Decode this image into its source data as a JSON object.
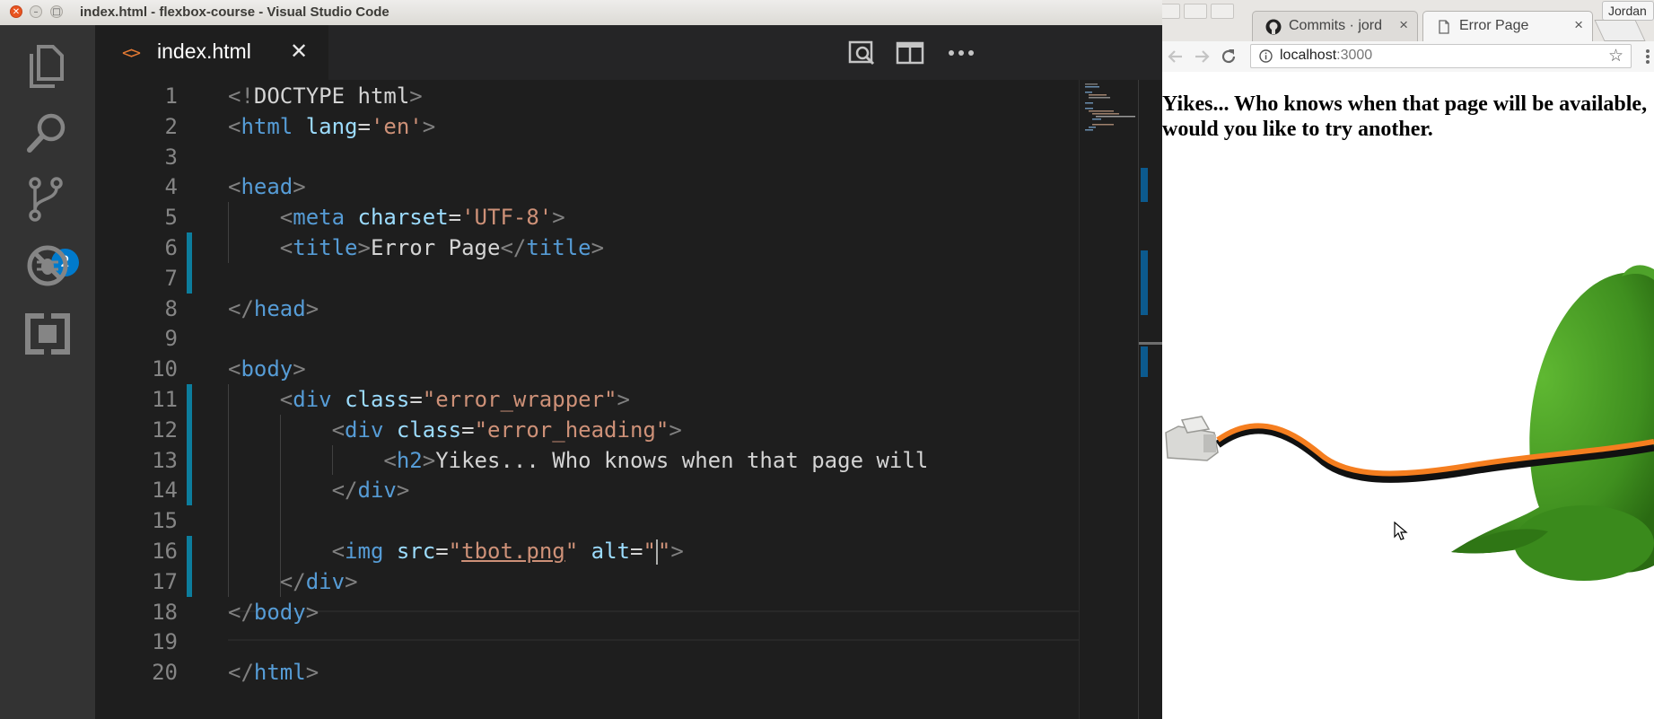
{
  "vscode": {
    "window_title": "index.html - flexbox-course - Visual Studio Code",
    "scm_badge": "2",
    "tab": {
      "label": "index.html",
      "close_icon": "✕",
      "file_icon": "<>"
    },
    "lines": [
      {
        "n": "1",
        "tokens": [
          [
            "p",
            "<!"
          ],
          [
            "txt",
            "DOCTYPE html"
          ],
          [
            "p",
            ">"
          ]
        ]
      },
      {
        "n": "2",
        "tokens": [
          [
            "p",
            "<"
          ],
          [
            "tag",
            "html"
          ],
          [
            "txt",
            " "
          ],
          [
            "attr",
            "lang"
          ],
          [
            "txt",
            "="
          ],
          [
            "str",
            "'en'"
          ],
          [
            "p",
            ">"
          ]
        ]
      },
      {
        "n": "3",
        "tokens": []
      },
      {
        "n": "4",
        "tokens": [
          [
            "p",
            "<"
          ],
          [
            "tag",
            "head"
          ],
          [
            "p",
            ">"
          ]
        ]
      },
      {
        "n": "5",
        "tokens": [
          [
            "txt",
            "    "
          ],
          [
            "p",
            "<"
          ],
          [
            "tag",
            "meta"
          ],
          [
            "txt",
            " "
          ],
          [
            "attr",
            "charset"
          ],
          [
            "txt",
            "="
          ],
          [
            "str",
            "'UTF-8'"
          ],
          [
            "p",
            ">"
          ]
        ]
      },
      {
        "n": "6",
        "tokens": [
          [
            "txt",
            "    "
          ],
          [
            "p",
            "<"
          ],
          [
            "tag",
            "title"
          ],
          [
            "p",
            ">"
          ],
          [
            "txt",
            "Error Page"
          ],
          [
            "p",
            "</"
          ],
          [
            "tag",
            "title"
          ],
          [
            "p",
            ">"
          ]
        ]
      },
      {
        "n": "7",
        "tokens": []
      },
      {
        "n": "8",
        "tokens": [
          [
            "p",
            "</"
          ],
          [
            "tag",
            "head"
          ],
          [
            "p",
            ">"
          ]
        ]
      },
      {
        "n": "9",
        "tokens": []
      },
      {
        "n": "10",
        "tokens": [
          [
            "p",
            "<"
          ],
          [
            "tag",
            "body"
          ],
          [
            "p",
            ">"
          ]
        ]
      },
      {
        "n": "11",
        "tokens": [
          [
            "txt",
            "    "
          ],
          [
            "p",
            "<"
          ],
          [
            "tag",
            "div"
          ],
          [
            "txt",
            " "
          ],
          [
            "attr",
            "class"
          ],
          [
            "txt",
            "="
          ],
          [
            "str",
            "\"error_wrapper\""
          ],
          [
            "p",
            ">"
          ]
        ]
      },
      {
        "n": "12",
        "tokens": [
          [
            "txt",
            "        "
          ],
          [
            "p",
            "<"
          ],
          [
            "tag",
            "div"
          ],
          [
            "txt",
            " "
          ],
          [
            "attr",
            "class"
          ],
          [
            "txt",
            "="
          ],
          [
            "str",
            "\"error_heading\""
          ],
          [
            "p",
            ">"
          ]
        ]
      },
      {
        "n": "13",
        "tokens": [
          [
            "txt",
            "            "
          ],
          [
            "p",
            "<"
          ],
          [
            "tag",
            "h2"
          ],
          [
            "p",
            ">"
          ],
          [
            "txt",
            "Yikes... Who knows when that page will"
          ]
        ]
      },
      {
        "n": "14",
        "tokens": [
          [
            "txt",
            "        "
          ],
          [
            "p",
            "</"
          ],
          [
            "tag",
            "div"
          ],
          [
            "p",
            ">"
          ]
        ]
      },
      {
        "n": "15",
        "tokens": []
      },
      {
        "n": "16",
        "tokens": [
          [
            "txt",
            "        "
          ],
          [
            "p",
            "<"
          ],
          [
            "tag",
            "img"
          ],
          [
            "txt",
            " "
          ],
          [
            "attr",
            "src"
          ],
          [
            "txt",
            "="
          ],
          [
            "str",
            "\""
          ],
          [
            "strlink",
            "tbot.png"
          ],
          [
            "str",
            "\""
          ],
          [
            "txt",
            " "
          ],
          [
            "attr",
            "alt"
          ],
          [
            "txt",
            "="
          ],
          [
            "str",
            "\""
          ],
          [
            "caret",
            ""
          ],
          [
            "str",
            "\""
          ],
          [
            "p",
            ">"
          ]
        ]
      },
      {
        "n": "17",
        "tokens": [
          [
            "txt",
            "    "
          ],
          [
            "p",
            "</"
          ],
          [
            "tag",
            "div"
          ],
          [
            "p",
            ">"
          ]
        ]
      },
      {
        "n": "18",
        "tokens": [
          [
            "p",
            "</"
          ],
          [
            "tag",
            "body"
          ],
          [
            "p",
            ">"
          ]
        ]
      },
      {
        "n": "19",
        "tokens": []
      },
      {
        "n": "20",
        "tokens": [
          [
            "p",
            "</"
          ],
          [
            "tag",
            "html"
          ],
          [
            "p",
            ">"
          ]
        ]
      }
    ],
    "modified_lines": [
      6,
      7,
      11,
      12,
      13,
      14,
      16,
      17
    ],
    "colors": {
      "tag": "#569cd6",
      "attr": "#9cdcfe",
      "string": "#ce9178",
      "punct": "#808080",
      "accent": "#007acc"
    }
  },
  "chrome": {
    "tabs": [
      {
        "label": "Commits · jord",
        "icon": "github-icon",
        "close_icon": "×"
      },
      {
        "label": "Error Page",
        "icon": "page-icon",
        "close_icon": "×"
      }
    ],
    "profile_label": "Jordan",
    "url_host": "localhost",
    "url_port": ":3000",
    "page_heading": "Yikes... Who knows when that page will be available, would you like to try another."
  }
}
